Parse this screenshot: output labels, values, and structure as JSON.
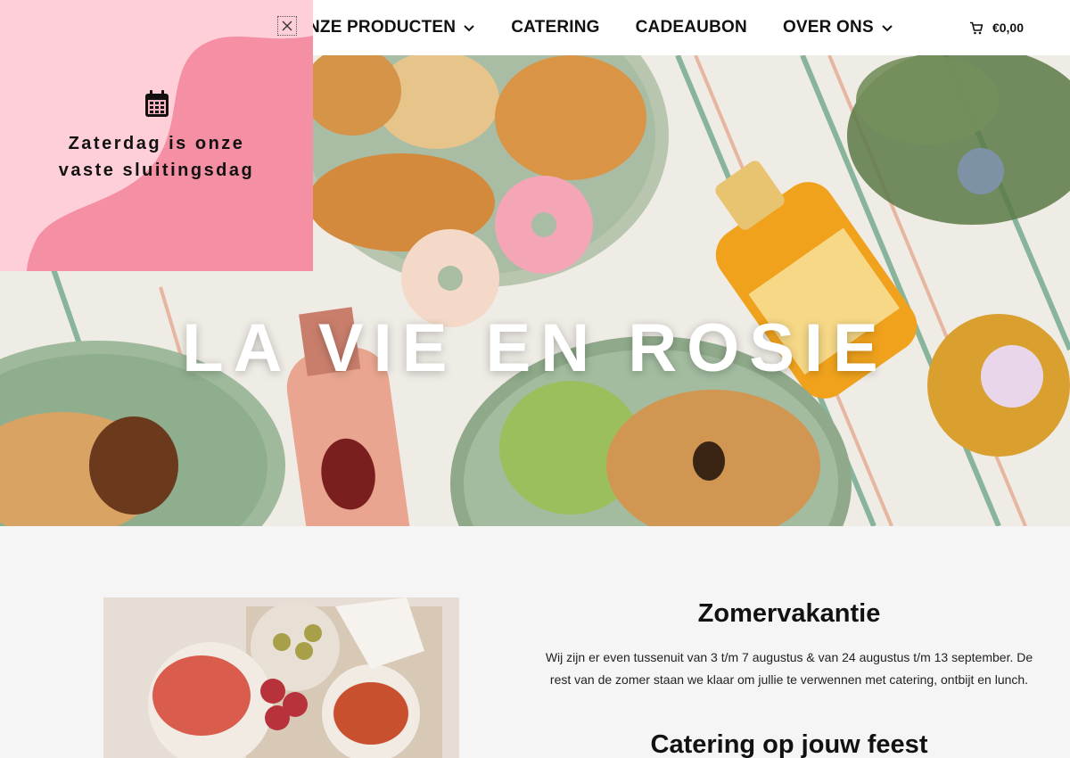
{
  "nav": {
    "items": [
      {
        "label": "ONZE PRODUCTEN",
        "has_dropdown": true
      },
      {
        "label": "CATERING",
        "has_dropdown": false
      },
      {
        "label": "CADEAUBON",
        "has_dropdown": false
      },
      {
        "label": "OVER ONS",
        "has_dropdown": true
      }
    ]
  },
  "cart": {
    "icon": "cart-icon",
    "total": "€0,00"
  },
  "hero": {
    "title": "LA VIE EN ROSIE"
  },
  "popup": {
    "icon": "calendar-icon",
    "line1": "Zaterdag is onze",
    "line2": "vaste sluitingsdag",
    "close_icon": "close-icon",
    "colors": {
      "background": "#ffcfd9",
      "blob": "#f58fa3"
    }
  },
  "article": {
    "heading": "Zomervakantie",
    "body_line1": "Wij zijn er even tussenuit van 3 t/m 7 augustus & van 24 augustus t/m 13 september. De",
    "body_line2": "rest van de zomer staan we klaar om jullie te verwennen met catering, ontbijt en lunch.",
    "heading2": "Catering op jouw feest"
  }
}
